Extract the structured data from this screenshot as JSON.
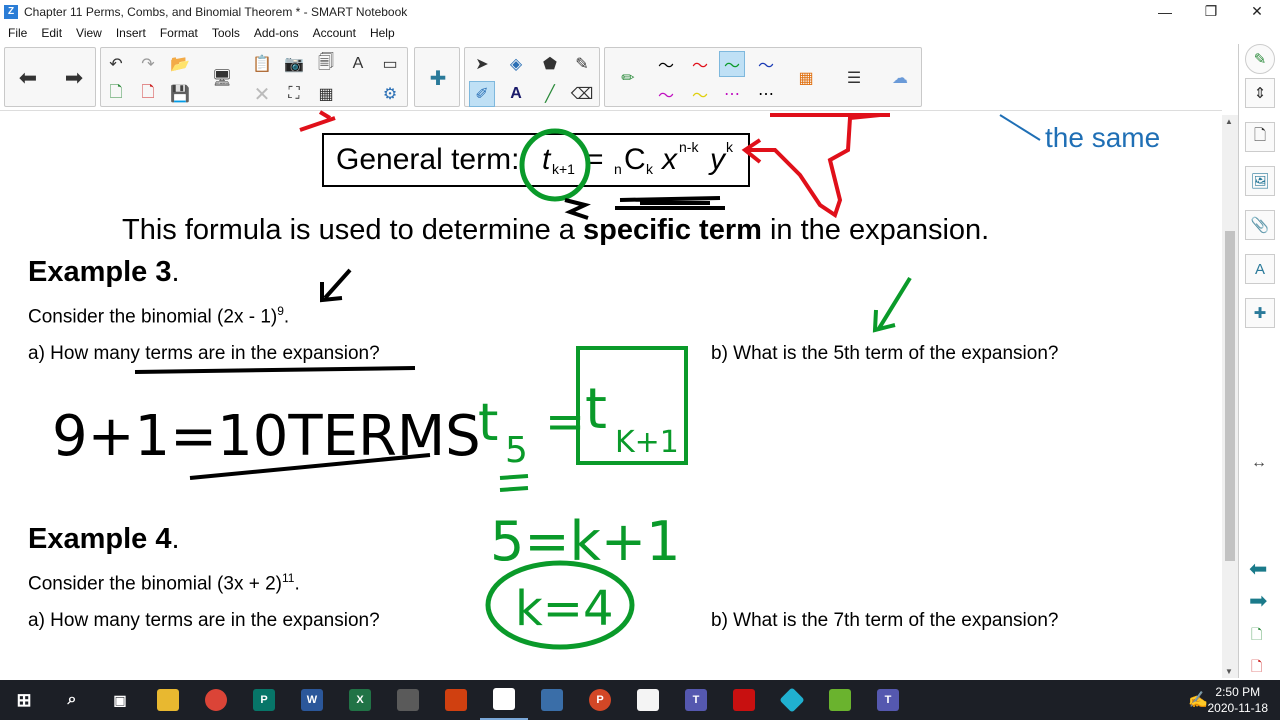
{
  "window": {
    "title": "Chapter 11 Perms, Combs, and Binomial Theorem * - SMART Notebook",
    "app_icon_letter": "Z",
    "minimize": "—",
    "maximize": "❐",
    "close": "✕"
  },
  "menu": [
    "File",
    "Edit",
    "View",
    "Insert",
    "Format",
    "Tools",
    "Add-ons",
    "Account",
    "Help"
  ],
  "slide": {
    "top_right_note": "the same",
    "general_term_label": "General term:",
    "formula_sentence_pre": "This formula is used to determine a ",
    "formula_sentence_bold": "specific term",
    "formula_sentence_post": " in the expansion.",
    "example3": {
      "heading": "Example 3",
      "binomial_text": "Consider the binomial (2x - 1)",
      "exponent": "9",
      "q_a": "a)  How many terms are in the expansion?",
      "q_b": "b)  What is the 5th term of the expansion?"
    },
    "example4": {
      "heading": "Example 4",
      "binomial_text": "Consider the binomial (3x + 2)",
      "exponent": "11",
      "q_a": "a)  How many terms are in the expansion?",
      "q_b": "b)  What is the 7th term of the expansion?"
    },
    "handwriting": {
      "answer_a": "9+1=10TERMS",
      "t5": "t5=tk+1",
      "eq": "5=k+1",
      "k": "k=4"
    }
  },
  "taskbar": {
    "time": "2:50 PM",
    "date": "2020-11-18"
  },
  "colors": {
    "ink_green": "#0a9a2a",
    "ink_red": "#e0101a",
    "ink_black": "#000000",
    "note_blue": "#1f6fb5",
    "taskbar_bg": "#1c1f26"
  }
}
